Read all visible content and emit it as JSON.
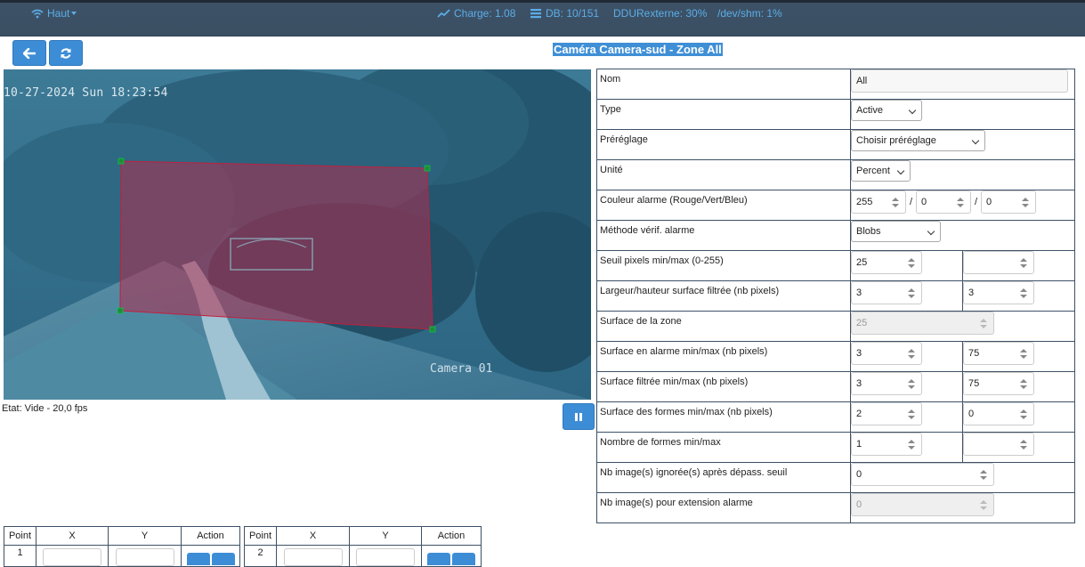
{
  "navbar": {
    "user_menu": "Haut",
    "charge": "Charge: 1.08",
    "db": "DB: 10/151",
    "ddu": "DDURexterne: 30%",
    "shm": "/dev/shm: 1%"
  },
  "page_title": "Caméra Camera-sud - Zone All",
  "camera": {
    "timestamp": "10-27-2024 Sun 18:23:54",
    "camera_label": "Camera 01",
    "status": "Etat: Vide - 20,0 fps"
  },
  "settings": {
    "rows": [
      {
        "label": "Nom",
        "value": "All"
      },
      {
        "label": "Type",
        "value": "Active"
      },
      {
        "label": "Préréglage",
        "value": "Choisir préréglage"
      },
      {
        "label": "Unité",
        "value": "Percent"
      },
      {
        "label": "Couleur alarme (Rouge/Vert/Bleu)",
        "r": "255",
        "g": "0",
        "b": "0"
      },
      {
        "label": "Méthode vérif. alarme",
        "value": "Blobs"
      },
      {
        "label": "Seuil pixels min/max (0-255)",
        "min": "25",
        "max": ""
      },
      {
        "label": "Largeur/hauteur surface filtrée (nb pixels)",
        "min": "3",
        "max": "3"
      },
      {
        "label": "Surface de la zone",
        "value": "25"
      },
      {
        "label": "Surface en alarme min/max (nb pixels)",
        "min": "3",
        "max": "75"
      },
      {
        "label": "Surface filtrée min/max (nb pixels)",
        "min": "3",
        "max": "75"
      },
      {
        "label": "Surface des formes min/max (nb pixels)",
        "min": "2",
        "max": "0"
      },
      {
        "label": "Nombre de formes min/max",
        "min": "1",
        "max": ""
      },
      {
        "label": "Nb image(s) ignorée(s) après dépass. seuil",
        "value": "0"
      },
      {
        "label": "Nb image(s) pour extension alarme",
        "value": "0"
      }
    ]
  },
  "points": {
    "headers": [
      "Point",
      "X",
      "Y",
      "Action"
    ],
    "tables": [
      {
        "point": "1",
        "x": "",
        "y": ""
      },
      {
        "point": "2",
        "x": "",
        "y": ""
      }
    ]
  }
}
